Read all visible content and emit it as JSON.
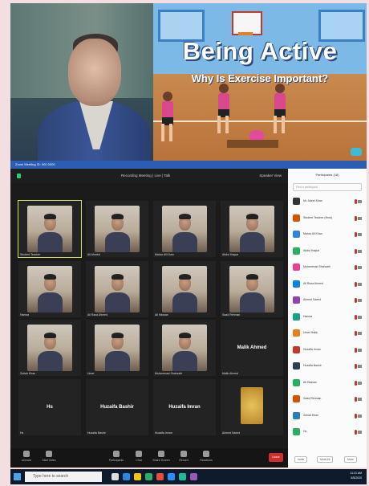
{
  "slide": {
    "title": "Being Active",
    "subtitle": "Why Is Exercise Important?"
  },
  "zoom": {
    "window_title": "Zoom Meeting ID: 000 0000",
    "meeting_title": "Recording Meeting | Live | Talk",
    "view_label": "Speaker View",
    "tiles": [
      {
        "name": "Student Teacher",
        "type": "video"
      },
      {
        "name": "Ali Ahmed",
        "type": "video"
      },
      {
        "name": "Mahar Ali Khan",
        "type": "video"
      },
      {
        "name": "Abdul Haque",
        "type": "video"
      },
      {
        "name": "Hamza",
        "type": "video"
      },
      {
        "name": "Ali Raza Ahmed",
        "type": "video"
      },
      {
        "name": "Ali Hassan",
        "type": "video"
      },
      {
        "name": "Saad Rehman",
        "type": "video"
      },
      {
        "name": "Zubair Khan",
        "type": "video"
      },
      {
        "name": "Umer",
        "type": "video"
      },
      {
        "name": "Muhammad Shahzaib",
        "type": "video"
      },
      {
        "name": "Malik Ahmed",
        "type": "name",
        "display": "Malik Ahmed"
      },
      {
        "name": "Hs",
        "type": "name",
        "display": "Hs"
      },
      {
        "name": "Huzaifa Bashir",
        "type": "name",
        "display": "Huzaifa Bashir"
      },
      {
        "name": "Huzaifa Imran",
        "type": "name",
        "display": "Huzaifa Imran"
      },
      {
        "name": "Ahmed Saeed",
        "type": "image"
      }
    ],
    "controls": [
      "Unmute",
      "Start Video",
      "Participants",
      "Chat",
      "Share Screen",
      "Record",
      "Reactions"
    ],
    "end_label": "Leave"
  },
  "panel": {
    "header": "Participants (18)",
    "search_placeholder": "Find a participant",
    "participants": [
      {
        "name": "Mr. Adeel Khan",
        "color": "#333333"
      },
      {
        "name": "Student Teacher (Host)",
        "color": "#d35400"
      },
      {
        "name": "Mahar Ali Khan",
        "color": "#2e86de"
      },
      {
        "name": "Abdul Haque",
        "color": "#27ae60"
      },
      {
        "name": "Muhammad Shahzaib",
        "color": "#e84393"
      },
      {
        "name": "Ali Raza Ahmed",
        "color": "#0984e3"
      },
      {
        "name": "Ahmed Saeed",
        "color": "#8e44ad"
      },
      {
        "name": "Hamza",
        "color": "#16a085"
      },
      {
        "name": "Umer Malik",
        "color": "#e67e22"
      },
      {
        "name": "Huzaifa Imran",
        "color": "#c0392b"
      },
      {
        "name": "Huzaifa Bashir",
        "color": "#2c3e50"
      },
      {
        "name": "Ali Hassan",
        "color": "#27ae60"
      },
      {
        "name": "Saad Rehman",
        "color": "#d35400"
      },
      {
        "name": "Zubair Khan",
        "color": "#2980b9"
      },
      {
        "name": "Hs",
        "color": "#27ae60"
      }
    ],
    "invite": "Invite",
    "mute_all": "Mute All",
    "more": "More"
  },
  "taskbar": {
    "search": "Type here to search",
    "time": "11:21 AM",
    "date": "5/5/2020"
  }
}
